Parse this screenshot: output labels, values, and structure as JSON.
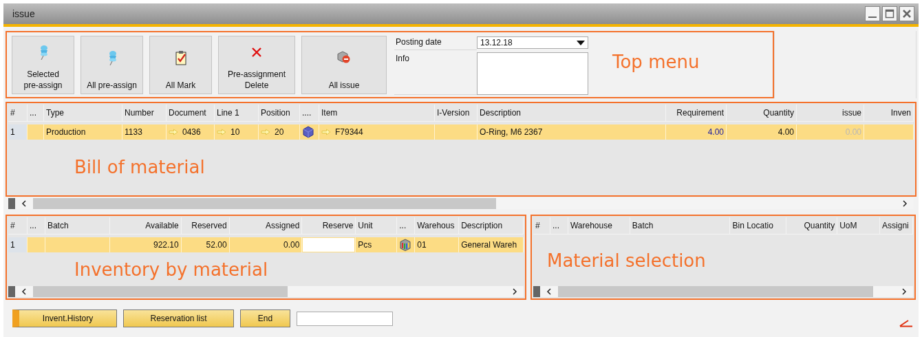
{
  "window": {
    "title": "issue"
  },
  "top_menu": {
    "annotation": "Top menu",
    "buttons": [
      {
        "label": "Selected\npre-assign",
        "kind": "pin"
      },
      {
        "label": "All pre-assign",
        "kind": "pin"
      },
      {
        "label": "All Mark",
        "kind": "mark"
      },
      {
        "label": "Pre-assignment\nDelete",
        "kind": "delete"
      },
      {
        "label": "All issue",
        "kind": "issue"
      }
    ],
    "posting_date": {
      "label": "Posting date",
      "value": "13.12.18"
    },
    "info": {
      "label": "Info"
    }
  },
  "bill_of_material": {
    "annotation": "Bill of material",
    "columns": [
      {
        "label": "#"
      },
      {
        "label": "..."
      },
      {
        "label": "Type"
      },
      {
        "label": "Number"
      },
      {
        "label": "Document"
      },
      {
        "label": "Line 1"
      },
      {
        "label": "Position"
      },
      {
        "label": "...."
      },
      {
        "label": "Item"
      },
      {
        "label": "I-Version"
      },
      {
        "label": "Description"
      },
      {
        "label": "Requirement"
      },
      {
        "label": "Quantity"
      },
      {
        "label": "issue"
      },
      {
        "label": "Inven"
      }
    ],
    "rows": [
      {
        "selected": true,
        "cells": [
          "1",
          null,
          "Production",
          "1133",
          {
            "text": "0436",
            "kind": "link"
          },
          {
            "text": "10",
            "kind": "link"
          },
          {
            "text": "20",
            "kind": "link"
          },
          {
            "kind": "item-icon"
          },
          {
            "text": "F79344",
            "kind": "link"
          },
          null,
          "O-Ring, M6 2367",
          {
            "text": "4.00",
            "kind": "emphasis"
          },
          "4.00",
          {
            "text": "0.00",
            "kind": "disabled"
          },
          null
        ]
      }
    ]
  },
  "inventory_by_material": {
    "annotation": "Inventory by material",
    "columns": [
      {
        "label": "#"
      },
      {
        "label": "..."
      },
      {
        "label": "Batch"
      },
      {
        "label": "Available"
      },
      {
        "label": "Reserved"
      },
      {
        "label": "Assigned"
      },
      {
        "label": "Reserve"
      },
      {
        "label": "Unit"
      },
      {
        "label": "..."
      },
      {
        "label": "Warehous"
      },
      {
        "label": "Description"
      }
    ],
    "rows": [
      {
        "selected": true,
        "cells": [
          "1",
          null,
          null,
          "922.10",
          "52.00",
          "0.00",
          {
            "kind": "input"
          },
          "Pcs",
          {
            "kind": "warehouse-icon"
          },
          "01",
          "General Wareh"
        ]
      }
    ]
  },
  "material_selection": {
    "annotation": "Material selection",
    "columns": [
      {
        "label": "#"
      },
      {
        "label": "..."
      },
      {
        "label": "Warehouse"
      },
      {
        "label": "Batch"
      },
      {
        "label": "Bin Locatio"
      },
      {
        "label": "Quantity"
      },
      {
        "label": "UoM"
      },
      {
        "label": "Assigni"
      }
    ]
  },
  "footer_buttons": [
    {
      "label": "Invent.History",
      "focused": true
    },
    {
      "label": "Reservation list",
      "focused": false
    },
    {
      "label": "End",
      "focused": false
    }
  ]
}
